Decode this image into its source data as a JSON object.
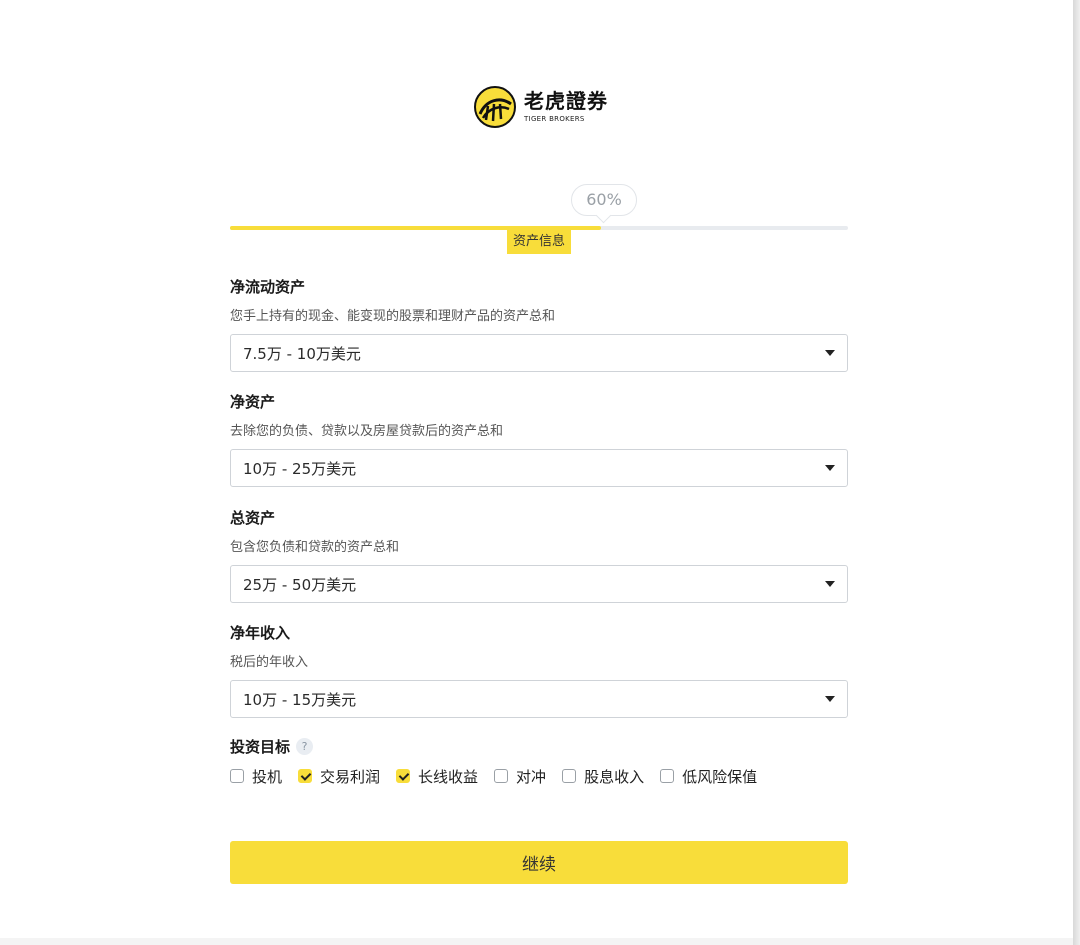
{
  "brand": {
    "name_cn": "老虎證券",
    "name_en": "TIGER BROKERS",
    "icon": "tiger-logo-icon"
  },
  "progress": {
    "percent_text": "60%",
    "fraction": 0.6,
    "step_label": "资产信息"
  },
  "fields": [
    {
      "title": "净流动资产",
      "description": "您手上持有的现金、能变现的股票和理财产品的资产总和",
      "value": "7.5万 - 10万美元"
    },
    {
      "title": "净资产",
      "description": "去除您的负债、贷款以及房屋贷款后的资产总和",
      "value": "10万 - 25万美元"
    },
    {
      "title": "总资产",
      "description": "包含您负债和贷款的资产总和",
      "value": "25万 - 50万美元"
    },
    {
      "title": "净年收入",
      "description": "税后的年收入",
      "value": "10万 - 15万美元"
    }
  ],
  "goals": {
    "title": "投资目标",
    "help_icon": "?",
    "options": [
      {
        "label": "投机",
        "checked": false
      },
      {
        "label": "交易利润",
        "checked": true
      },
      {
        "label": "长线收益",
        "checked": true
      },
      {
        "label": "对冲",
        "checked": false
      },
      {
        "label": "股息收入",
        "checked": false
      },
      {
        "label": "低风险保值",
        "checked": false
      }
    ]
  },
  "continue_label": "继续",
  "colors": {
    "accent": "#f8dd3a",
    "track": "#e8ebef"
  }
}
